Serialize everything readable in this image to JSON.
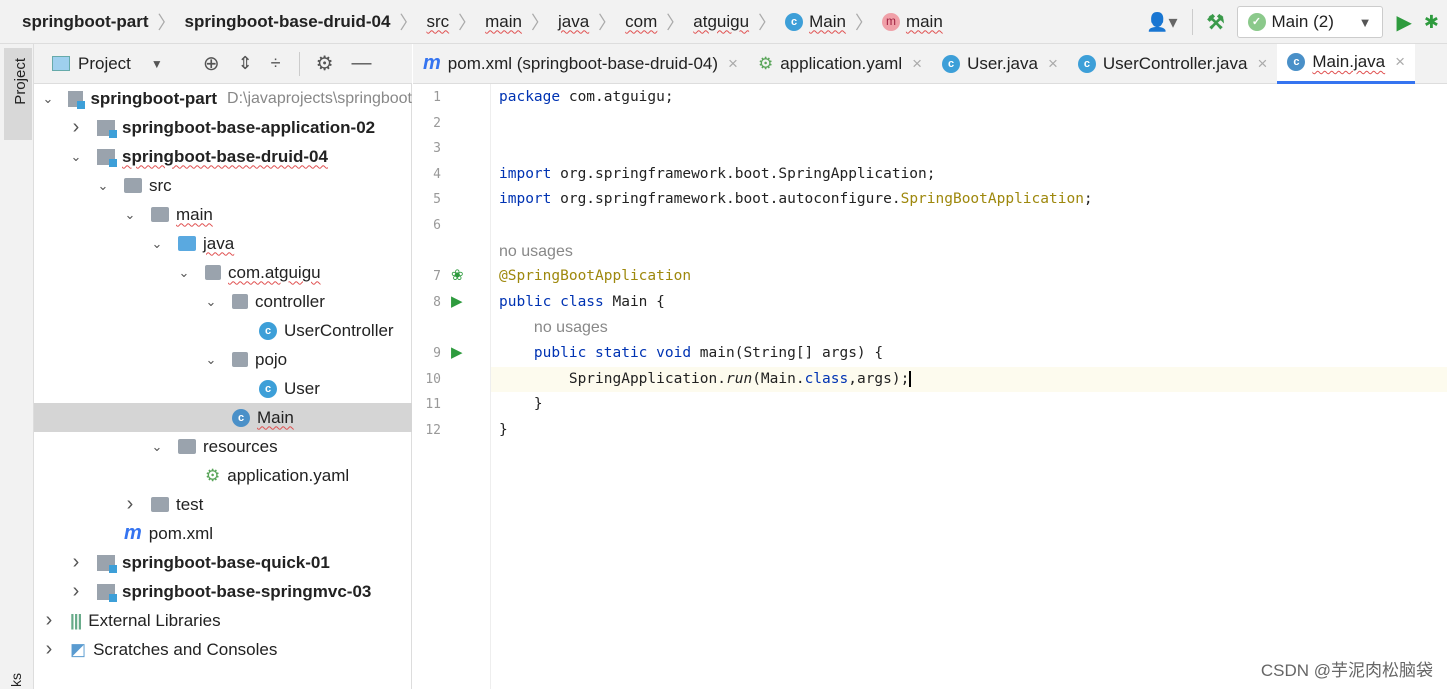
{
  "breadcrumb": [
    "springboot-part",
    "springboot-base-druid-04",
    "src",
    "main",
    "java",
    "com",
    "atguigu",
    "Main",
    "main"
  ],
  "toolbar": {
    "run_config": "Main (2)",
    "icons": [
      "user-icon",
      "hammer-icon",
      "run-icon",
      "debug-icon"
    ]
  },
  "sidebar": {
    "tab_label": "Project",
    "bottom_label": "ks"
  },
  "project_panel": {
    "title": "Project",
    "icons": [
      "locate-icon",
      "expand-all-icon",
      "collapse-all-icon",
      "gear-icon",
      "minimize-icon"
    ]
  },
  "tree": [
    {
      "label": "springboot-part",
      "hint": "D:\\javaprojects\\springboot",
      "level": 0,
      "arrow": "down",
      "type": "module",
      "bold": true
    },
    {
      "label": "springboot-base-application-02",
      "level": 1,
      "arrow": "right",
      "type": "module",
      "bold": true
    },
    {
      "label": "springboot-base-druid-04",
      "level": 1,
      "arrow": "down",
      "type": "module",
      "bold": true,
      "squig": true
    },
    {
      "label": "src",
      "level": 2,
      "arrow": "down",
      "type": "folder"
    },
    {
      "label": "main",
      "level": 3,
      "arrow": "down",
      "type": "folder",
      "squig": true
    },
    {
      "label": "java",
      "level": 4,
      "arrow": "down",
      "type": "jfolder",
      "squig": true
    },
    {
      "label": "com.atguigu",
      "level": 5,
      "arrow": "down",
      "type": "package",
      "squig": true
    },
    {
      "label": "controller",
      "level": 6,
      "arrow": "down",
      "type": "package"
    },
    {
      "label": "UserController",
      "level": 7,
      "arrow": "",
      "type": "class"
    },
    {
      "label": "pojo",
      "level": 6,
      "arrow": "down",
      "type": "package"
    },
    {
      "label": "User",
      "level": 7,
      "arrow": "",
      "type": "class"
    },
    {
      "label": "Main",
      "level": 6,
      "arrow": "",
      "type": "boot",
      "selected": true,
      "squig": true
    },
    {
      "label": "resources",
      "level": 4,
      "arrow": "down",
      "type": "folder"
    },
    {
      "label": "application.yaml",
      "level": 5,
      "arrow": "",
      "type": "yaml"
    },
    {
      "label": "test",
      "level": 3,
      "arrow": "right",
      "type": "folder"
    },
    {
      "label": "pom.xml",
      "level": 2,
      "arrow": "",
      "type": "maven"
    },
    {
      "label": "springboot-base-quick-01",
      "level": 1,
      "arrow": "right",
      "type": "module",
      "bold": true
    },
    {
      "label": "springboot-base-springmvc-03",
      "level": 1,
      "arrow": "right",
      "type": "module",
      "bold": true
    },
    {
      "label": "External Libraries",
      "level": 0,
      "arrow": "right",
      "type": "lib"
    },
    {
      "label": "Scratches and Consoles",
      "level": 0,
      "arrow": "right",
      "type": "scratch"
    }
  ],
  "tabs": [
    {
      "label": "pom.xml (springboot-base-druid-04)",
      "icon": "maven"
    },
    {
      "label": "application.yaml",
      "icon": "yaml"
    },
    {
      "label": "User.java",
      "icon": "class"
    },
    {
      "label": "UserController.java",
      "icon": "class"
    },
    {
      "label": "Main.java",
      "icon": "boot",
      "active": true
    }
  ],
  "editor": {
    "current_line": 10,
    "lines": [
      {
        "n": "1",
        "html": "<span class='kw'>package</span> com.atguigu;"
      },
      {
        "n": "2",
        "html": ""
      },
      {
        "n": "3",
        "html": ""
      },
      {
        "n": "4",
        "html": "<span class='kw'>import</span> org.springframework.boot.SpringApplication;"
      },
      {
        "n": "5",
        "html": "<span class='kw'>import</span> org.springframework.boot.autoconfigure.<span class='an'>SpringBootApplication</span>;"
      },
      {
        "n": "6",
        "html": ""
      },
      {
        "n": "",
        "html": "<span class='hint'>no usages</span>"
      },
      {
        "n": "7",
        "html": "<span class='an'>@SpringBootApplication</span>",
        "gicon": "spring"
      },
      {
        "n": "8",
        "html": "<span class='kw'>public class</span> Main {",
        "gicon": "run"
      },
      {
        "n": "",
        "html": "    <span class='hint'>no usages</span>"
      },
      {
        "n": "9",
        "html": "    <span class='kw'>public static void</span> main(String[] args) {",
        "gicon": "run"
      },
      {
        "n": "10",
        "html": "        SpringApplication.<span class='it'>run</span>(Main.<span class='kw'>class</span>,args);<span style='border-left:2px solid #000'></span>"
      },
      {
        "n": "11",
        "html": "    }"
      },
      {
        "n": "12",
        "html": "}"
      }
    ]
  },
  "watermark": "CSDN @芋泥肉松脑袋"
}
